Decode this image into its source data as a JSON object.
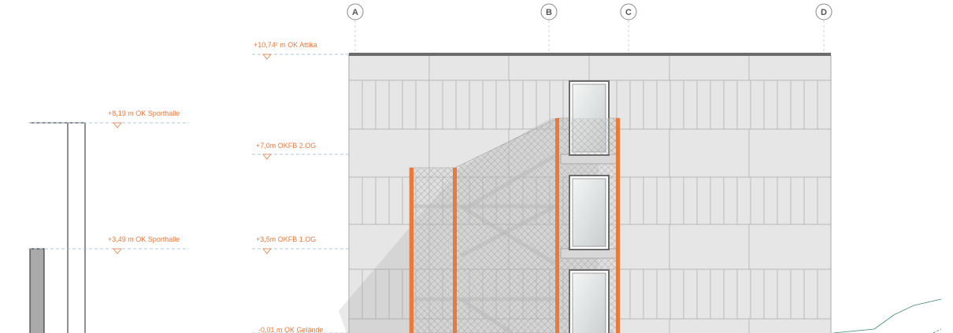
{
  "axes": [
    {
      "id": "A",
      "label": "A"
    },
    {
      "id": "B",
      "label": "B"
    },
    {
      "id": "C",
      "label": "C"
    },
    {
      "id": "D",
      "label": "D"
    }
  ],
  "levels": {
    "attika": "+10,74²  m OK Attika",
    "og2": "+7,0m OKFB 2.OG",
    "og1": "+3,5m OKFB 1.OG",
    "gelaende": "-0,01  m OK Gelände",
    "sporthalle_top": "+8,19 m OK Sporthalle",
    "sporthalle_mid": "+3,49 m OK Sporthalle"
  },
  "colors": {
    "facade": "#e6e6e6",
    "facade_line": "#a9a9a9",
    "accent": "#e87a3c",
    "datum_line": "#8fb8c8",
    "terrain": "#3e8c6c",
    "roof": "#6b6b6b"
  }
}
